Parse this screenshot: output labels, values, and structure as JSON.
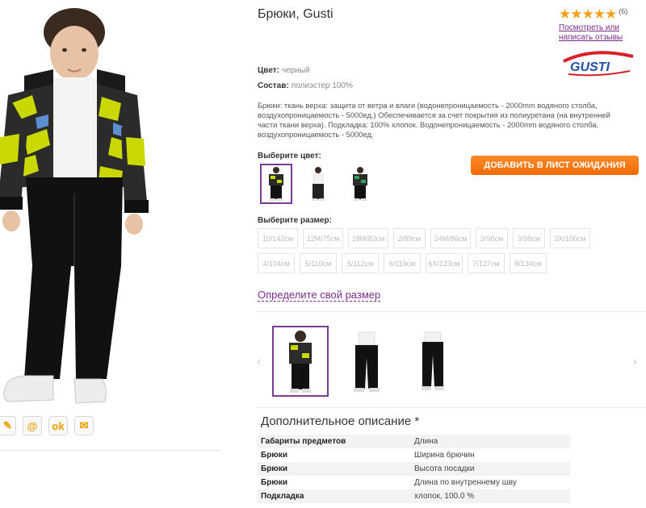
{
  "product": {
    "title": "Брюки, Gusti",
    "rating_stars": "★★★★★",
    "rating_count": "(6)",
    "review_link": "Посмотреть или написать отзывы",
    "brand": "GUSTI",
    "color_label": "Цвет:",
    "color_value": "черный",
    "composition_label": "Состав:",
    "composition_value": "полиэстер 100%",
    "description": "Брюки: ткань верха: защита от ветра и влаги (водонепроницаемость - 2000mm водяного столба, воздухопроницаемость - 5000ед.) Обеспечивается за счет покрытия из полиуретана (на внутренней части ткани верха). Подкладка: 100% хлопок. Водонепроницаемость - 2000mm водяного столба, воздухопроницаемость - 5000ед."
  },
  "colors": {
    "label": "Выберите цвет:",
    "items": [
      "jacket-pants-set",
      "pants-front",
      "jacket-pants-set-alt"
    ]
  },
  "wishlist_button": "ДОБАВИТЬ В ЛИСТ ОЖИДАНИЯ",
  "sizes": {
    "label": "Выберите размер:",
    "items": [
      "10/142см",
      "12M/75см",
      "18M/82см",
      "2/89см",
      "24M/86см",
      "3/96см",
      "3/98см",
      "3X/100см",
      "4/104см",
      "5/110см",
      "5/112см",
      "6/119см",
      "6X/123см",
      "7/127см",
      "8/134см"
    ]
  },
  "size_link": "Определите свой размер",
  "share": {
    "icons": [
      "edit-icon",
      "at-icon",
      "odnoklassniki-icon",
      "mail-icon"
    ]
  },
  "gallery": {
    "prev": "‹",
    "next": "›"
  },
  "extra": {
    "title": "Дополнительное описание *",
    "rows": [
      {
        "k": "Габариты предметов",
        "v": "Длина"
      },
      {
        "k": "Брюки",
        "v": "Ширина брючин"
      },
      {
        "k": "Брюки",
        "v": "Высота посадки"
      },
      {
        "k": "Брюки",
        "v": "Длина по внутреннему шву"
      },
      {
        "k": "Подкладка",
        "v": "хлопок, 100.0 %"
      }
    ]
  },
  "colors_palette": {
    "accent_purple": "#7a3b97",
    "button_orange": "#f47a10",
    "star_orange": "#f8a01c"
  }
}
